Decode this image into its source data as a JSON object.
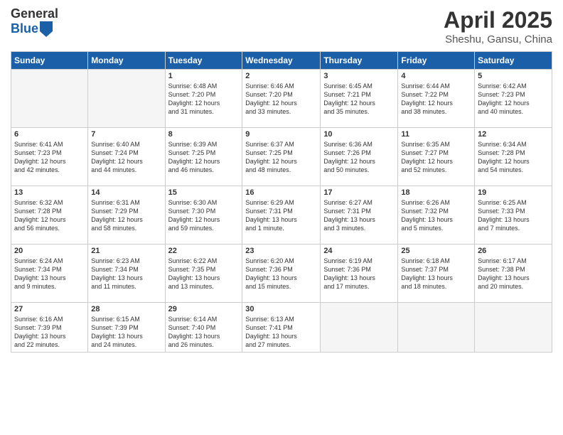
{
  "logo": {
    "general": "General",
    "blue": "Blue"
  },
  "title": {
    "month": "April 2025",
    "location": "Sheshu, Gansu, China"
  },
  "days_of_week": [
    "Sunday",
    "Monday",
    "Tuesday",
    "Wednesday",
    "Thursday",
    "Friday",
    "Saturday"
  ],
  "weeks": [
    [
      {
        "day": "",
        "info": ""
      },
      {
        "day": "",
        "info": ""
      },
      {
        "day": "1",
        "info": "Sunrise: 6:48 AM\nSunset: 7:20 PM\nDaylight: 12 hours\nand 31 minutes."
      },
      {
        "day": "2",
        "info": "Sunrise: 6:46 AM\nSunset: 7:20 PM\nDaylight: 12 hours\nand 33 minutes."
      },
      {
        "day": "3",
        "info": "Sunrise: 6:45 AM\nSunset: 7:21 PM\nDaylight: 12 hours\nand 35 minutes."
      },
      {
        "day": "4",
        "info": "Sunrise: 6:44 AM\nSunset: 7:22 PM\nDaylight: 12 hours\nand 38 minutes."
      },
      {
        "day": "5",
        "info": "Sunrise: 6:42 AM\nSunset: 7:23 PM\nDaylight: 12 hours\nand 40 minutes."
      }
    ],
    [
      {
        "day": "6",
        "info": "Sunrise: 6:41 AM\nSunset: 7:23 PM\nDaylight: 12 hours\nand 42 minutes."
      },
      {
        "day": "7",
        "info": "Sunrise: 6:40 AM\nSunset: 7:24 PM\nDaylight: 12 hours\nand 44 minutes."
      },
      {
        "day": "8",
        "info": "Sunrise: 6:39 AM\nSunset: 7:25 PM\nDaylight: 12 hours\nand 46 minutes."
      },
      {
        "day": "9",
        "info": "Sunrise: 6:37 AM\nSunset: 7:25 PM\nDaylight: 12 hours\nand 48 minutes."
      },
      {
        "day": "10",
        "info": "Sunrise: 6:36 AM\nSunset: 7:26 PM\nDaylight: 12 hours\nand 50 minutes."
      },
      {
        "day": "11",
        "info": "Sunrise: 6:35 AM\nSunset: 7:27 PM\nDaylight: 12 hours\nand 52 minutes."
      },
      {
        "day": "12",
        "info": "Sunrise: 6:34 AM\nSunset: 7:28 PM\nDaylight: 12 hours\nand 54 minutes."
      }
    ],
    [
      {
        "day": "13",
        "info": "Sunrise: 6:32 AM\nSunset: 7:28 PM\nDaylight: 12 hours\nand 56 minutes."
      },
      {
        "day": "14",
        "info": "Sunrise: 6:31 AM\nSunset: 7:29 PM\nDaylight: 12 hours\nand 58 minutes."
      },
      {
        "day": "15",
        "info": "Sunrise: 6:30 AM\nSunset: 7:30 PM\nDaylight: 12 hours\nand 59 minutes."
      },
      {
        "day": "16",
        "info": "Sunrise: 6:29 AM\nSunset: 7:31 PM\nDaylight: 13 hours\nand 1 minute."
      },
      {
        "day": "17",
        "info": "Sunrise: 6:27 AM\nSunset: 7:31 PM\nDaylight: 13 hours\nand 3 minutes."
      },
      {
        "day": "18",
        "info": "Sunrise: 6:26 AM\nSunset: 7:32 PM\nDaylight: 13 hours\nand 5 minutes."
      },
      {
        "day": "19",
        "info": "Sunrise: 6:25 AM\nSunset: 7:33 PM\nDaylight: 13 hours\nand 7 minutes."
      }
    ],
    [
      {
        "day": "20",
        "info": "Sunrise: 6:24 AM\nSunset: 7:34 PM\nDaylight: 13 hours\nand 9 minutes."
      },
      {
        "day": "21",
        "info": "Sunrise: 6:23 AM\nSunset: 7:34 PM\nDaylight: 13 hours\nand 11 minutes."
      },
      {
        "day": "22",
        "info": "Sunrise: 6:22 AM\nSunset: 7:35 PM\nDaylight: 13 hours\nand 13 minutes."
      },
      {
        "day": "23",
        "info": "Sunrise: 6:20 AM\nSunset: 7:36 PM\nDaylight: 13 hours\nand 15 minutes."
      },
      {
        "day": "24",
        "info": "Sunrise: 6:19 AM\nSunset: 7:36 PM\nDaylight: 13 hours\nand 17 minutes."
      },
      {
        "day": "25",
        "info": "Sunrise: 6:18 AM\nSunset: 7:37 PM\nDaylight: 13 hours\nand 18 minutes."
      },
      {
        "day": "26",
        "info": "Sunrise: 6:17 AM\nSunset: 7:38 PM\nDaylight: 13 hours\nand 20 minutes."
      }
    ],
    [
      {
        "day": "27",
        "info": "Sunrise: 6:16 AM\nSunset: 7:39 PM\nDaylight: 13 hours\nand 22 minutes."
      },
      {
        "day": "28",
        "info": "Sunrise: 6:15 AM\nSunset: 7:39 PM\nDaylight: 13 hours\nand 24 minutes."
      },
      {
        "day": "29",
        "info": "Sunrise: 6:14 AM\nSunset: 7:40 PM\nDaylight: 13 hours\nand 26 minutes."
      },
      {
        "day": "30",
        "info": "Sunrise: 6:13 AM\nSunset: 7:41 PM\nDaylight: 13 hours\nand 27 minutes."
      },
      {
        "day": "",
        "info": ""
      },
      {
        "day": "",
        "info": ""
      },
      {
        "day": "",
        "info": ""
      }
    ]
  ]
}
